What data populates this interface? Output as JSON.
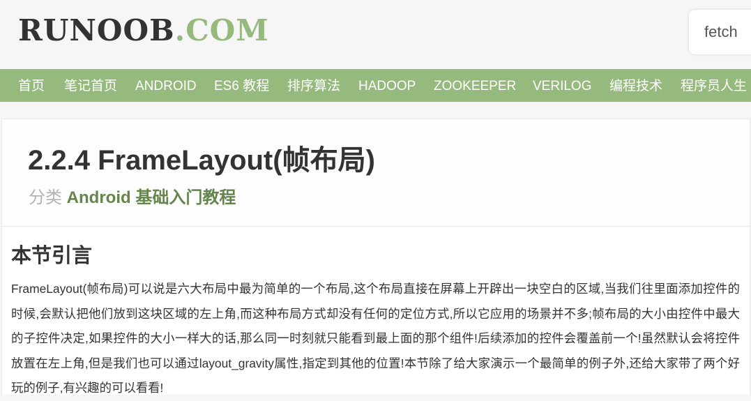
{
  "header": {
    "logo_part1": "RUNOOB",
    "logo_part2": ".COM",
    "search_value": "fetch"
  },
  "nav": {
    "items": [
      "首页",
      "笔记首页",
      "ANDROID",
      "ES6 教程",
      "排序算法",
      "HADOOP",
      "ZOOKEEPER",
      "VERILOG",
      "编程技术",
      "程序员人生"
    ]
  },
  "article": {
    "title": "2.2.4 FrameLayout(帧布局)",
    "category_label": "分类",
    "category_link": "Android 基础入门教程",
    "section_heading": "本节引言",
    "paragraph": "FrameLayout(帧布局)可以说是六大布局中最为简单的一个布局,这个布局直接在屏幕上开辟出一块空白的区域,当我们往里面添加控件的时候,会默认把他们放到这块区域的左上角,而这种布局方式却没有任何的定位方式,所以它应用的场景并不多;帧布局的大小由控件中最大的子控件决定,如果控件的大小一样大的话,那么同一时刻就只能看到最上面的那个组件!后续添加的控件会覆盖前一个!虽然默认会将控件放置在左上角,但是我们也可以通过layout_gravity属性,指定到其他的位置!本节除了给大家演示一个最简单的例子外,还给大家带了两个好玩的例子,有兴趣的可以看看!"
  },
  "colors": {
    "accent": "#96b97d",
    "category_link": "#64854c",
    "text": "#333333"
  }
}
